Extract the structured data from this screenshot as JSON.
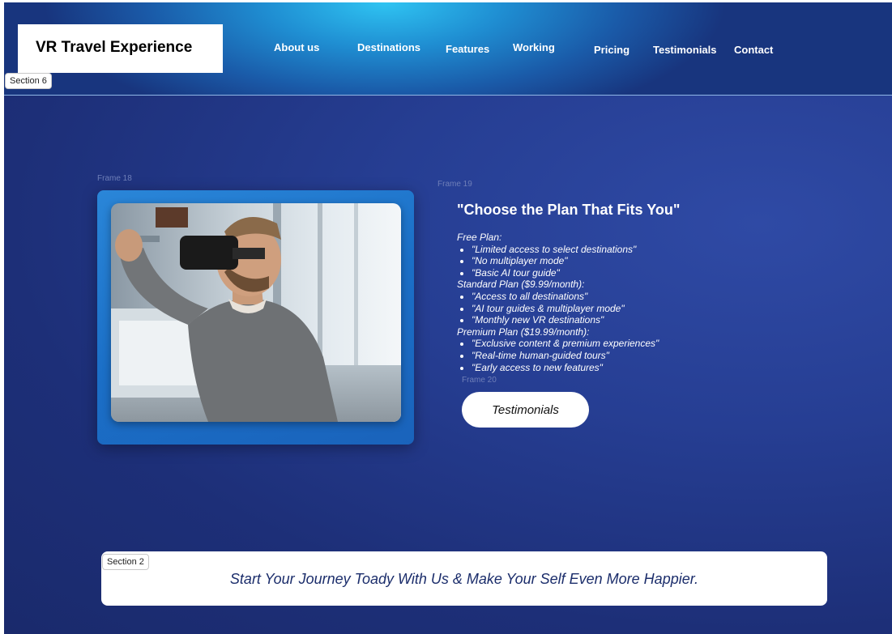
{
  "brand": {
    "title": "VR Travel Experience"
  },
  "nav": {
    "items": [
      "About us",
      "Destinations",
      "Features",
      "Working",
      "Pricing",
      "Testimonials",
      "Contact"
    ]
  },
  "section_tags": {
    "top": "Section 6",
    "bottom": "Section 2"
  },
  "frames": {
    "image_frame": "Frame 18",
    "content_frame": "Frame 19",
    "button_frame": "Frame 20"
  },
  "pricing": {
    "title": "\"Choose the Plan That Fits You\"",
    "plans": [
      {
        "name": "Free Plan:",
        "features": [
          "\"Limited access to select destinations\"",
          "\"No multiplayer mode\"",
          "\"Basic AI tour guide\""
        ]
      },
      {
        "name": "Standard Plan ($9.99/month):",
        "features": [
          "\"Access to all destinations\"",
          "\"AI tour guides & multiplayer mode\"",
          "\"Monthly new VR destinations\""
        ]
      },
      {
        "name": "Premium Plan ($19.99/month):",
        "features": [
          "\"Exclusive content & premium experiences\"",
          "\"Real-time human-guided tours\"",
          "\"Early access to new features\""
        ]
      }
    ],
    "button_label": "Testimonials"
  },
  "banner": {
    "text": "Start Your Journey Toady With Us & Make Your Self Even More Happier."
  },
  "colors": {
    "header_accent": "#2fc4f2",
    "page_bg": "#1d2f78",
    "frame_bg": "#1b6fc7"
  }
}
